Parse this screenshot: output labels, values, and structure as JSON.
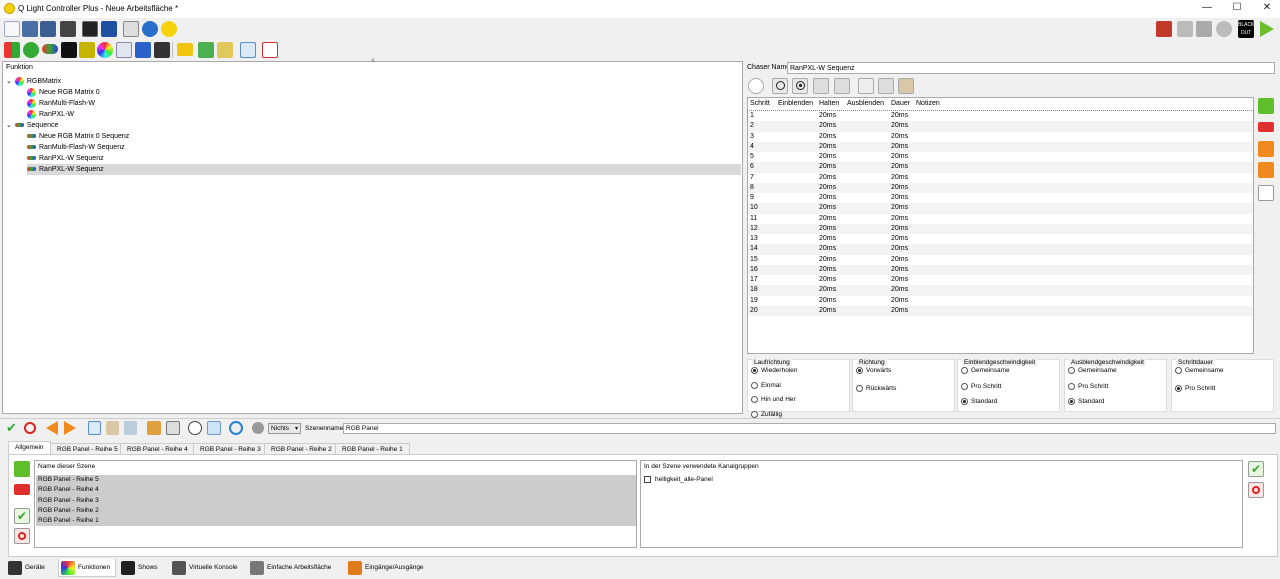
{
  "window": {
    "title": "Q Light Controller Plus - Neue Arbeitsfläche *",
    "min": "—",
    "max": "☐",
    "close": "✕"
  },
  "tree": {
    "header": "Funktion",
    "items": [
      {
        "label": "RGBMatrix",
        "level": 0,
        "icon": "rgbmatrix-folder-icon"
      },
      {
        "label": "Neue RGB Matrix 0",
        "level": 1,
        "icon": "rgbmatrix-icon"
      },
      {
        "label": "RanMulti-Flash-W",
        "level": 1,
        "icon": "rgbmatrix-icon"
      },
      {
        "label": "RanPXL-W",
        "level": 1,
        "icon": "rgbmatrix-icon"
      },
      {
        "label": "Sequence",
        "level": 0,
        "icon": "sequence-folder-icon"
      },
      {
        "label": "Neue RGB Matrix 0 Sequenz",
        "level": 1,
        "icon": "sequence-icon"
      },
      {
        "label": "RanMulti-Flash-W Sequenz",
        "level": 1,
        "icon": "sequence-icon"
      },
      {
        "label": "RanPXL-W Sequenz",
        "level": 1,
        "icon": "sequence-icon"
      },
      {
        "label": "RanPXL-W Sequenz",
        "level": 1,
        "icon": "sequence-icon",
        "selected": true
      }
    ]
  },
  "chaser": {
    "name_label": "Chaser Name",
    "name_value": "RanPXL-W Sequenz",
    "columns": [
      "Schritt",
      "Einblenden",
      "Halten",
      "Ausblenden",
      "Dauer",
      "Notizen"
    ],
    "steps": [
      {
        "n": "1",
        "hold": "20ms",
        "dur": "20ms"
      },
      {
        "n": "2",
        "hold": "20ms",
        "dur": "20ms"
      },
      {
        "n": "3",
        "hold": "20ms",
        "dur": "20ms"
      },
      {
        "n": "4",
        "hold": "20ms",
        "dur": "20ms"
      },
      {
        "n": "5",
        "hold": "20ms",
        "dur": "20ms"
      },
      {
        "n": "6",
        "hold": "20ms",
        "dur": "20ms"
      },
      {
        "n": "7",
        "hold": "20ms",
        "dur": "20ms"
      },
      {
        "n": "8",
        "hold": "20ms",
        "dur": "20ms"
      },
      {
        "n": "9",
        "hold": "20ms",
        "dur": "20ms"
      },
      {
        "n": "10",
        "hold": "20ms",
        "dur": "20ms"
      },
      {
        "n": "11",
        "hold": "20ms",
        "dur": "20ms"
      },
      {
        "n": "12",
        "hold": "20ms",
        "dur": "20ms"
      },
      {
        "n": "13",
        "hold": "20ms",
        "dur": "20ms"
      },
      {
        "n": "14",
        "hold": "20ms",
        "dur": "20ms"
      },
      {
        "n": "15",
        "hold": "20ms",
        "dur": "20ms"
      },
      {
        "n": "16",
        "hold": "20ms",
        "dur": "20ms"
      },
      {
        "n": "17",
        "hold": "20ms",
        "dur": "20ms"
      },
      {
        "n": "18",
        "hold": "20ms",
        "dur": "20ms"
      },
      {
        "n": "19",
        "hold": "20ms",
        "dur": "20ms"
      },
      {
        "n": "20",
        "hold": "20ms",
        "dur": "20ms"
      }
    ],
    "groups": {
      "laufrichtung": {
        "title": "Laufrichtung",
        "options": [
          "Wiederholen",
          "Einmal",
          "Hin und Her",
          "Zufällig"
        ],
        "selected": 0
      },
      "richtung": {
        "title": "Richtung",
        "options": [
          "Vorwärts",
          "Rückwärts"
        ],
        "selected": 0
      },
      "einblend": {
        "title": "Einblendgeschwindigkeit",
        "options": [
          "Gemeinsame",
          "Pro Schritt",
          "Standard"
        ],
        "selected": 2
      },
      "ausblend": {
        "title": "Ausblendgeschwindigkeit",
        "options": [
          "Gemeinsame",
          "Pro Schritt",
          "Standard"
        ],
        "selected": 2
      },
      "schritt": {
        "title": "Schrittdauer",
        "options": [
          "Gemeinsame",
          "Pro Schritt"
        ],
        "selected": 1
      }
    }
  },
  "scene": {
    "dropdown": "Nichts",
    "name_label": "Szenenname:",
    "name_value": "RGB Panel",
    "tabs": [
      "Allgemein",
      "RGB Panel - Reihe 5",
      "RGB Panel - Reihe 4",
      "RGB Panel - Reihe 3",
      "RGB Panel - Reihe 2",
      "RGB Panel - Reihe 1"
    ],
    "list_header": "Name dieser Szene",
    "list": [
      "RGB Panel - Reihe 5",
      "RGB Panel - Reihe 4",
      "RGB Panel - Reihe 3",
      "RGB Panel - Reihe 2",
      "RGB Panel - Reihe 1"
    ],
    "groups_header": "In der Szene verwendete Kanalgruppen",
    "groups": [
      "helligkeit_alle-Panel"
    ]
  },
  "bottom_tabs": [
    {
      "label": "Geräte",
      "icon": "fixtures-icon"
    },
    {
      "label": "Funktionen",
      "icon": "functions-icon",
      "active": true
    },
    {
      "label": "Shows",
      "icon": "shows-icon"
    },
    {
      "label": "Virtuelle Konsole",
      "icon": "virtual-console-icon"
    },
    {
      "label": "Einfache Arbeitsfläche",
      "icon": "simple-desk-icon"
    },
    {
      "label": "Eingänge/Ausgänge",
      "icon": "io-icon"
    }
  ],
  "toolbar_icons": [
    "new-icon",
    "save-icon",
    "save-as-icon",
    "kiosk-icon",
    "fullscreen-icon",
    "monitor-icon",
    "help-icon",
    "about-icon"
  ],
  "right_icons": [
    "output-icon",
    "fader-icon",
    "disable-icon",
    "stop-all-icon",
    "blackout-icon",
    "play-icon"
  ],
  "blackout_label": "BLACK OUT",
  "colors": {
    "selected_row": "#d9d9d9",
    "scene_row": "#cccccc",
    "green": "#5fbf2a",
    "red": "#e0302e",
    "orange": "#f08a1d",
    "blue": "#2a7fd1"
  }
}
